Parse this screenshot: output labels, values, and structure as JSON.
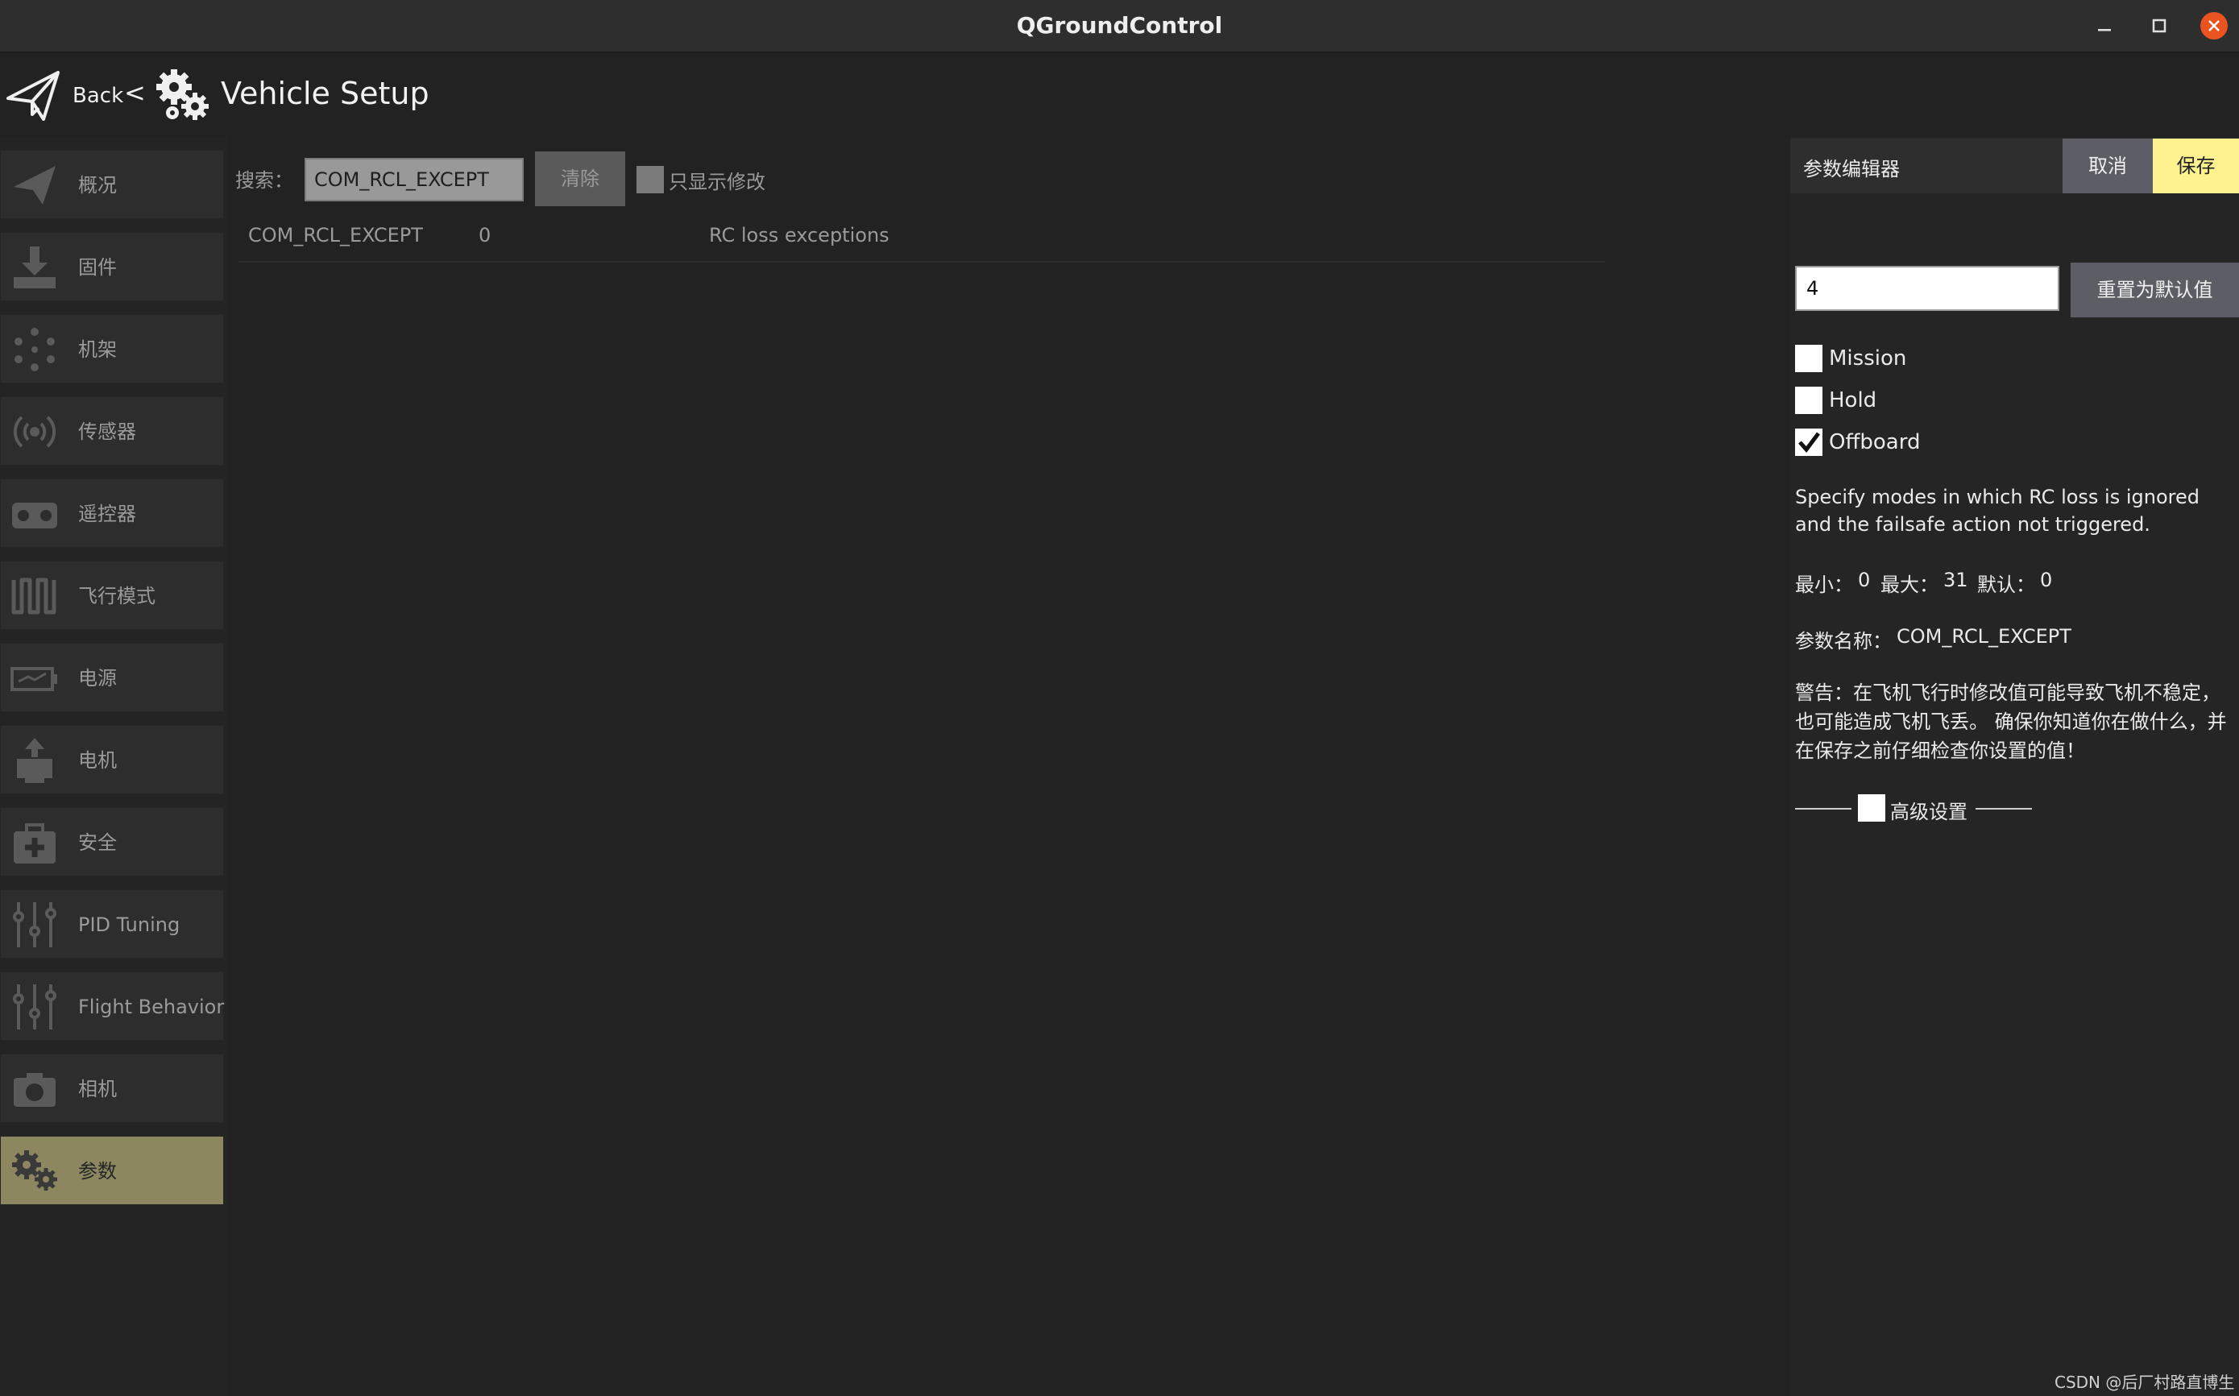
{
  "window": {
    "title": "QGroundControl"
  },
  "header": {
    "back_label": "Back",
    "separator": "<",
    "page_title": "Vehicle Setup"
  },
  "sidebar": {
    "items": [
      {
        "label": "概况",
        "icon": "paper-plane-icon",
        "active": false
      },
      {
        "label": "固件",
        "icon": "download-icon",
        "active": false
      },
      {
        "label": "机架",
        "icon": "airframe-dots-icon",
        "active": false
      },
      {
        "label": "传感器",
        "icon": "sensor-icon",
        "active": false
      },
      {
        "label": "遥控器",
        "icon": "radio-controller-icon",
        "active": false
      },
      {
        "label": "飞行模式",
        "icon": "flight-mode-wave-icon",
        "active": false
      },
      {
        "label": "电源",
        "icon": "battery-icon",
        "active": false
      },
      {
        "label": "电机",
        "icon": "motor-icon",
        "active": false
      },
      {
        "label": "安全",
        "icon": "first-aid-kit-icon",
        "active": false
      },
      {
        "label": "PID Tuning",
        "icon": "sliders-icon",
        "active": false
      },
      {
        "label": "Flight Behavior",
        "icon": "sliders-icon",
        "active": false
      },
      {
        "label": "相机",
        "icon": "camera-icon",
        "active": false
      },
      {
        "label": "参数",
        "icon": "gears-icon",
        "active": true
      }
    ]
  },
  "search": {
    "label": "搜索：",
    "value": "COM_RCL_EXCEPT",
    "clear_label": "清除",
    "modified_only_label": "只显示修改"
  },
  "params": {
    "rows": [
      {
        "name": "COM_RCL_EXCEPT",
        "value": "0",
        "description": "RC loss exceptions"
      }
    ]
  },
  "editor": {
    "title": "参数编辑器",
    "cancel_label": "取消",
    "save_label": "保存",
    "value": "4",
    "reset_label": "重置为默认值",
    "options": [
      {
        "label": "Mission",
        "checked": false
      },
      {
        "label": "Hold",
        "checked": false
      },
      {
        "label": "Offboard",
        "checked": true
      }
    ],
    "description": "Specify modes in which RC loss is ignored and the failsafe action not triggered.",
    "min_label": "最小：",
    "min_value": "0",
    "max_label": "最大：",
    "max_value": "31",
    "default_label": "默认：",
    "default_value": "0",
    "param_name_label": "参数名称：",
    "param_name": "COM_RCL_EXCEPT",
    "warning": "警告：在飞机飞行时修改值可能导致飞机不稳定，也可能造成飞机飞丢。 确保你知道你在做什么，并在保存之前仔细检查你设置的值！",
    "advanced_label": "高级设置"
  },
  "watermark": "CSDN @后厂村路直博生",
  "colors": {
    "background": "#222222",
    "active_item": "#8d8760",
    "save_button": "#fdf28f",
    "close_button": "#e95420"
  }
}
